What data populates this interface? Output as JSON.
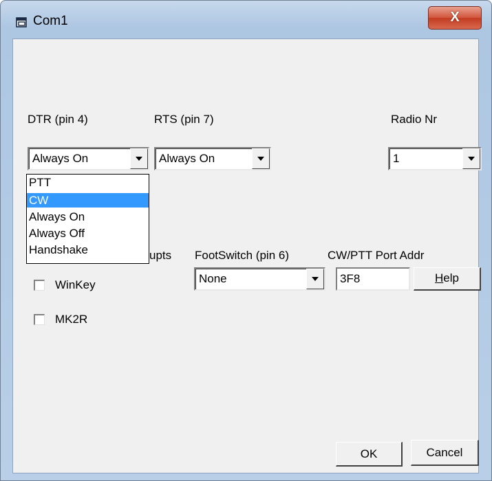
{
  "window": {
    "title": "Com1",
    "close_label": "X"
  },
  "dtr": {
    "label": "DTR (pin 4)",
    "value": "Always On",
    "options": [
      "PTT",
      "CW",
      "Always On",
      "Always Off",
      "Handshake"
    ],
    "highlighted": "CW"
  },
  "rts": {
    "label": "RTS (pin 7)",
    "value": "Always On"
  },
  "radio_nr": {
    "label": "Radio Nr",
    "value": "1"
  },
  "interrupts": {
    "label_visible": "upts"
  },
  "footswitch": {
    "label": "FootSwitch (pin 6)",
    "value": "None"
  },
  "port_addr": {
    "label": "CW/PTT Port Addr",
    "value": "3F8"
  },
  "help_button": {
    "label_underlined": "H",
    "label_rest": "elp"
  },
  "winkey": {
    "label": "WinKey",
    "checked": false
  },
  "mk2r": {
    "label": "MK2R",
    "checked": false
  },
  "ok_button": {
    "label": "OK"
  },
  "cancel_button": {
    "label": "Cancel"
  }
}
